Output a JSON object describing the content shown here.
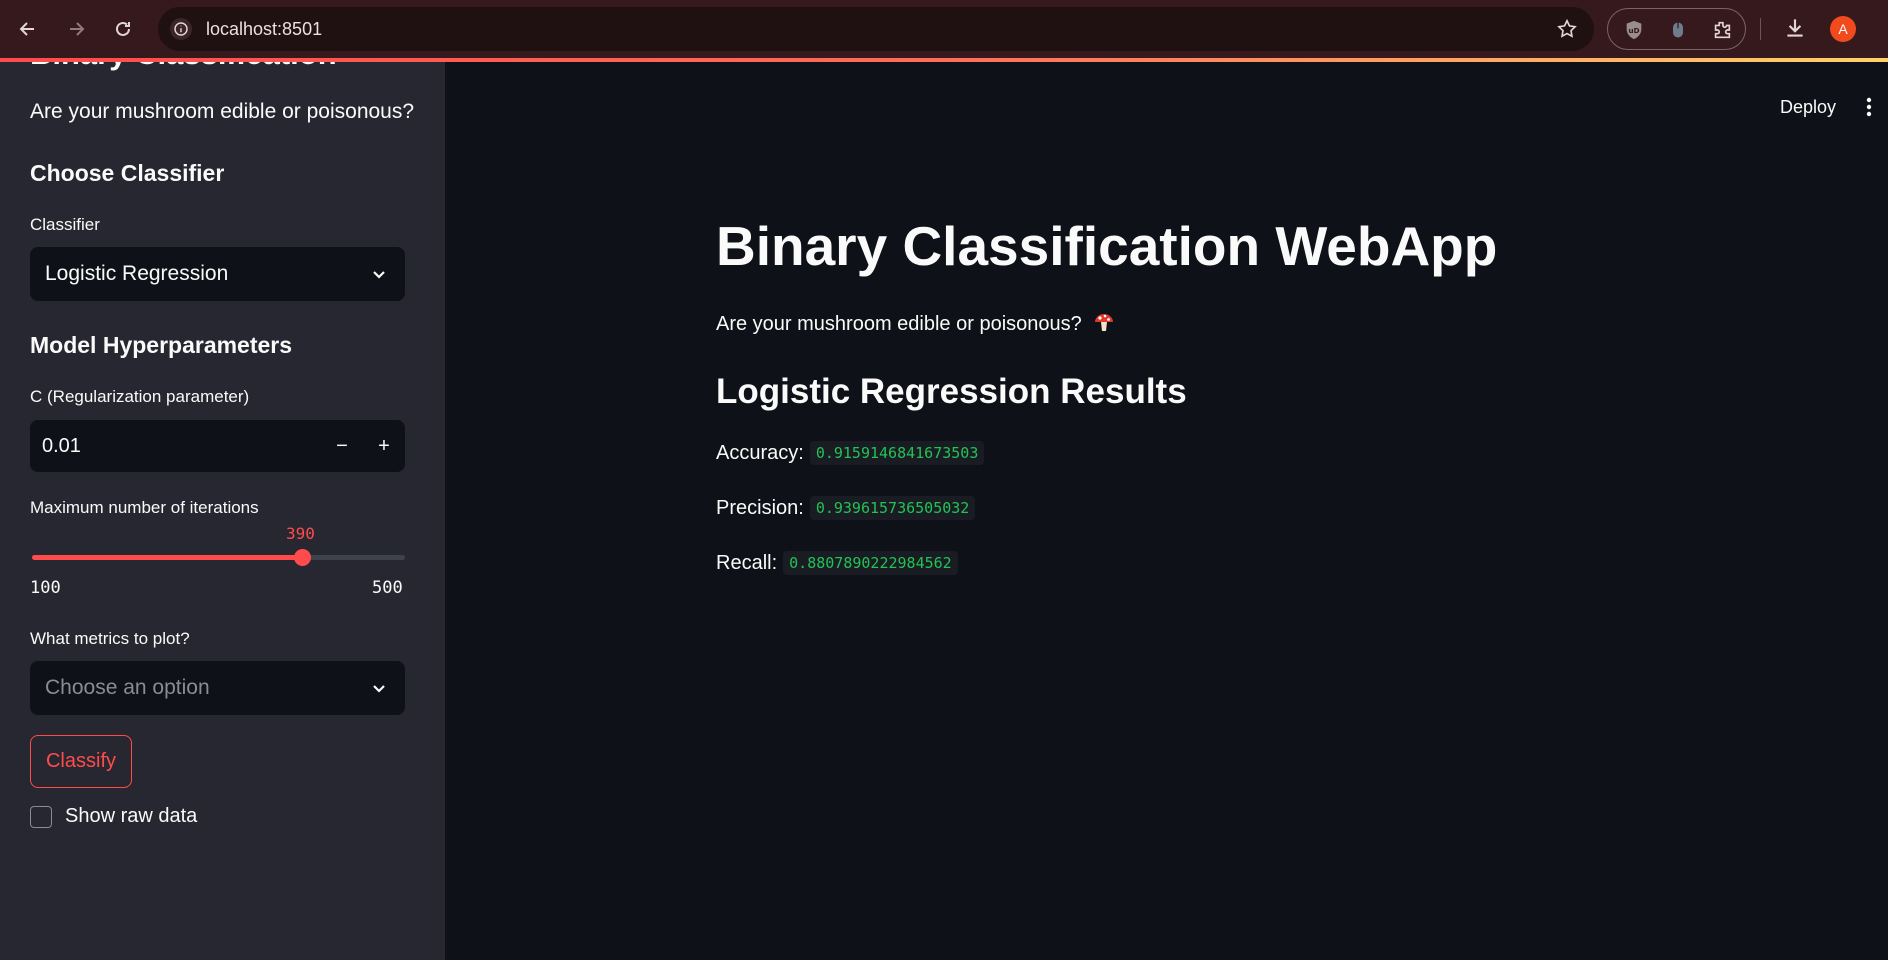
{
  "browser": {
    "url": "localhost:8501",
    "profile_initial": "A"
  },
  "sidebar": {
    "title": "Binary Classification",
    "subtitle": "Are your mushroom edible or poisonous?",
    "choose_classifier_heading": "Choose Classifier",
    "classifier_label": "Classifier",
    "classifier_value": "Logistic Regression",
    "hyperparams_heading": "Model Hyperparameters",
    "c_label": "C (Regularization parameter)",
    "c_value": "0.01",
    "c_decrement": "−",
    "c_increment": "+",
    "iter_label": "Maximum number of iterations",
    "iter_value": "390",
    "iter_min": "100",
    "iter_max": "500",
    "metrics_label": "What metrics to plot?",
    "metrics_placeholder": "Choose an option",
    "classify_button": "Classify",
    "raw_data_label": "Show raw data"
  },
  "header": {
    "deploy_label": "Deploy"
  },
  "main": {
    "title": "Binary Classification WebApp",
    "subtitle": "Are your mushroom edible or poisonous?",
    "results_title": "Logistic Regression Results",
    "metrics": [
      {
        "label": "Accuracy:",
        "value": "0.9159146841673503"
      },
      {
        "label": "Precision:",
        "value": "0.939615736505032"
      },
      {
        "label": "Recall:",
        "value": "0.8807890222984562"
      }
    ]
  },
  "colors": {
    "accent": "#ff4b4b",
    "code_green": "#21c354",
    "sidebar_bg": "#262730",
    "main_bg": "#0e1117"
  }
}
